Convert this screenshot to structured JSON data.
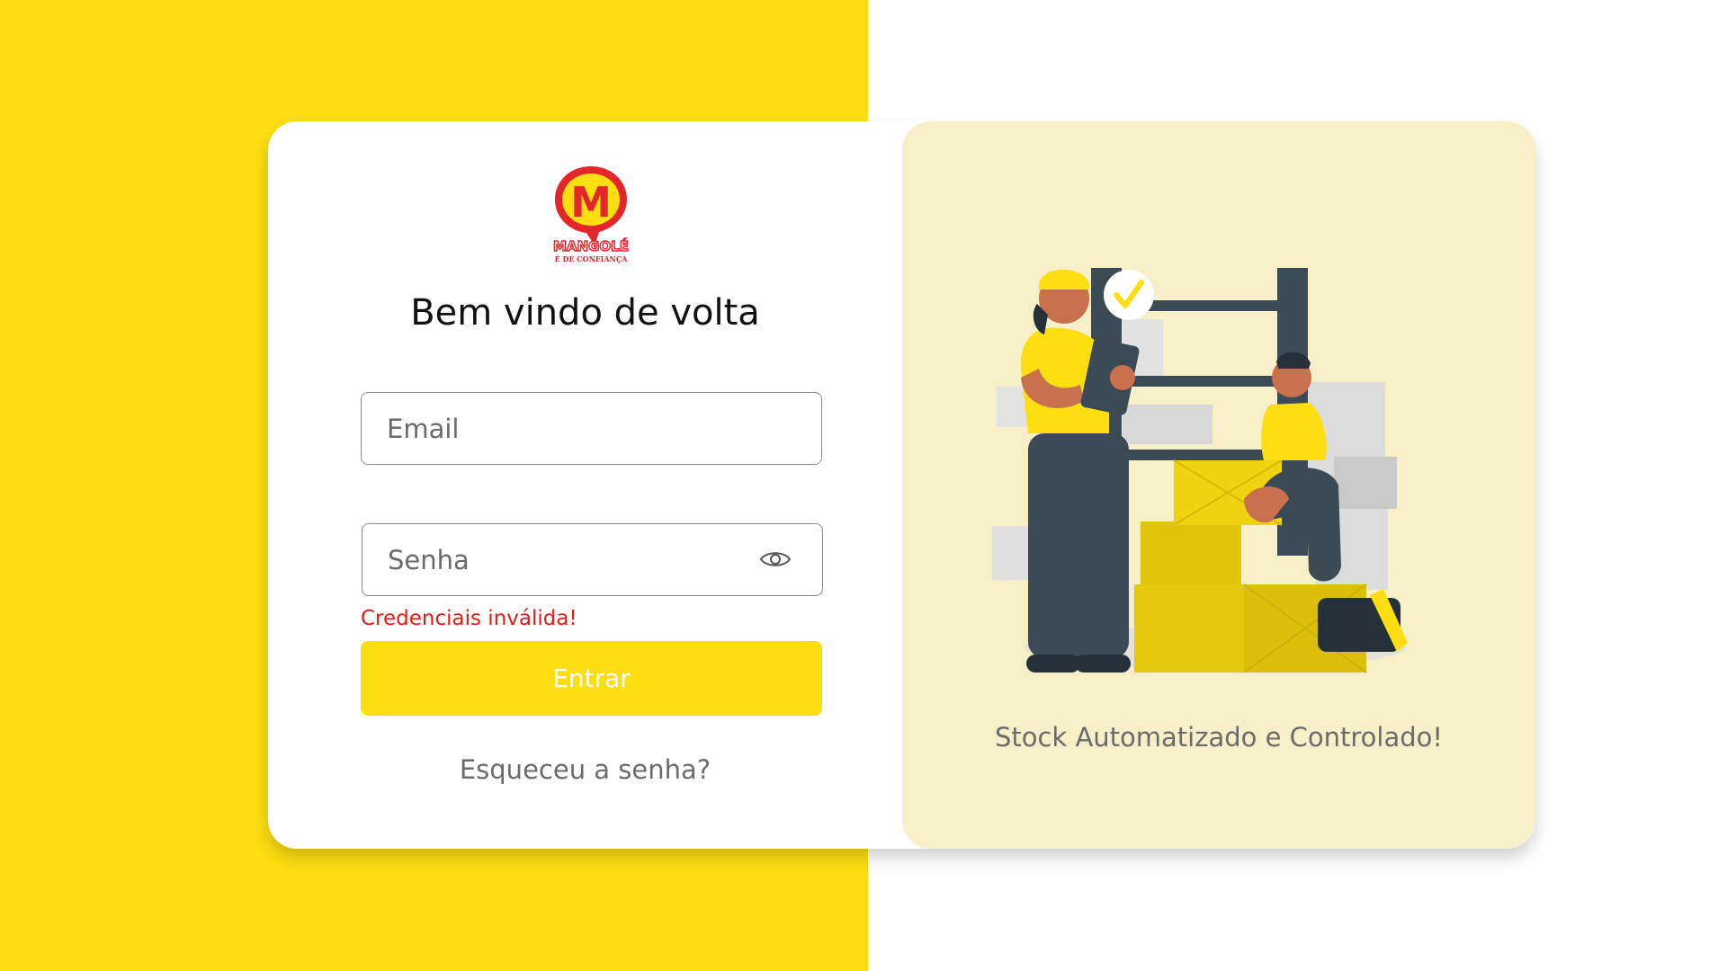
{
  "brand": {
    "name": "MANGOLÉ",
    "tagline": "É DE CONFIANÇA",
    "logo_letter": "M"
  },
  "login": {
    "title": "Bem vindo de volta",
    "email_placeholder": "Email",
    "password_placeholder": "Senha",
    "error_message": "Credenciais inválida!",
    "submit_label": "Entrar",
    "forgot_label": "Esqueceu a senha?"
  },
  "promo": {
    "caption": "Stock Automatizado e Controlado!"
  },
  "colors": {
    "brand_yellow": "#fcde11",
    "promo_background": "#f6efc8",
    "error_red": "#e41b17",
    "logo_red": "#e3262a"
  },
  "icons": {
    "password_toggle": "eye-icon"
  }
}
